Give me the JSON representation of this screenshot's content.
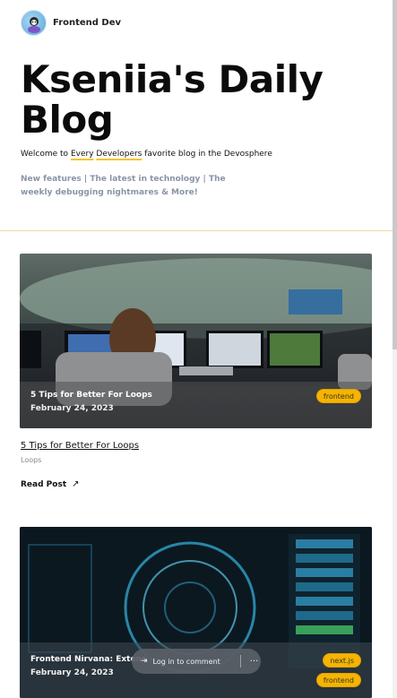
{
  "header": {
    "brand": "Frontend Dev",
    "avatar_icon": "avatar-icon"
  },
  "hero": {
    "title": "Kseniia's Daily Blog",
    "intro_prefix": "Welcome to ",
    "intro_highlight_1": "Every",
    "intro_highlight_2": "Developers",
    "intro_suffix": " favorite blog in the Devosphere",
    "tagline": "New features | The latest in technology | The weekly debugging nightmares & More!"
  },
  "posts": [
    {
      "overlay_title": "5 Tips for Better For Loops",
      "date": "February 24, 2023",
      "tags": [
        "frontend"
      ],
      "title": "5 Tips for Better For Loops",
      "category": "Loops",
      "read_more": "Read Post",
      "arrow_icon": "↗"
    },
    {
      "overlay_title": "Frontend Nirvana: Extens",
      "date": "February 24, 2023",
      "tags": [
        "next.js",
        "frontend"
      ]
    }
  ],
  "toolbar": {
    "login_label": "Log in to comment",
    "more_label": "···"
  },
  "colors": {
    "accent": "#f6b400",
    "divider": "#f2d9a0",
    "tagline": "#8a94a6"
  }
}
